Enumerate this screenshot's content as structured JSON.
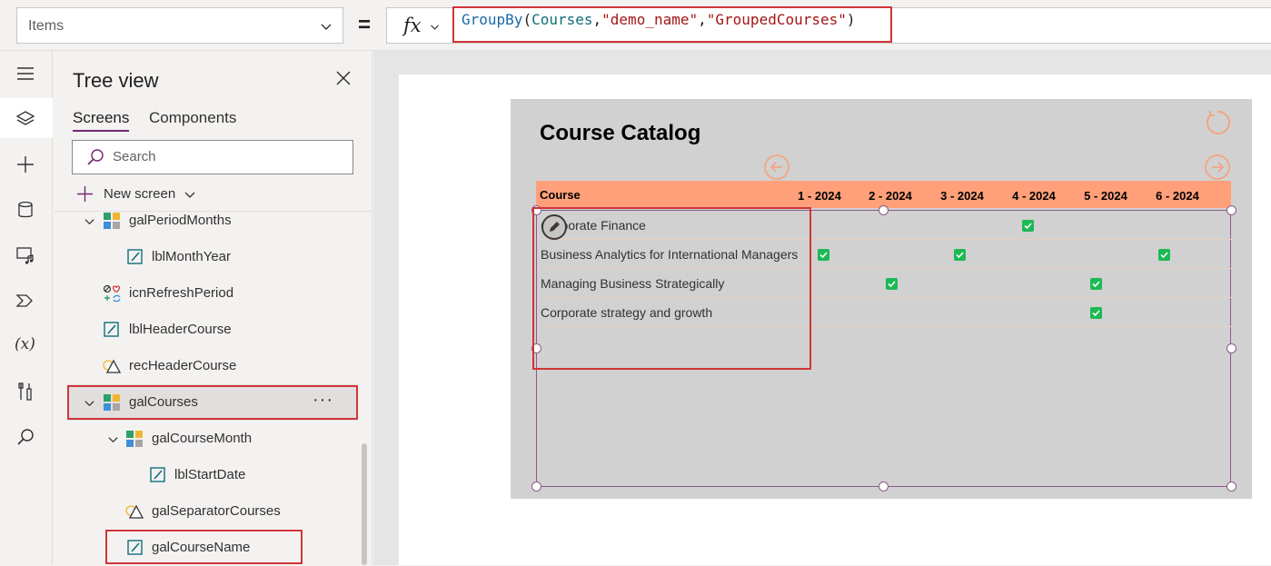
{
  "formula_bar": {
    "property": "Items",
    "fx_label": "fx",
    "equals": "=",
    "formula": {
      "fn": "GroupBy",
      "open": "(",
      "source": "Courses",
      "comma1": ",",
      "arg1": "\"demo_name\"",
      "comma2": ",",
      "arg2": "\"GroupedCourses\"",
      "close": ")"
    }
  },
  "rail": {
    "items": [
      "menu-icon",
      "layers-icon",
      "insert-icon",
      "data-icon",
      "media-icon",
      "power-automate-icon",
      "variables-icon",
      "tools-icon",
      "search-icon"
    ],
    "variables_glyph": "(x)"
  },
  "tree": {
    "title": "Tree view",
    "tabs": [
      "Screens",
      "Components"
    ],
    "search_placeholder": "Search",
    "new_screen_label": "New screen",
    "nodes": [
      {
        "label": "galPeriodMonths",
        "icon": "gallery-icon"
      },
      {
        "label": "lblMonthYear",
        "icon": "label-icon"
      },
      {
        "label": "icnRefreshPeriod",
        "icon": "icon-control-icon"
      },
      {
        "label": "lblHeaderCourse",
        "icon": "label-icon"
      },
      {
        "label": "recHeaderCourse",
        "icon": "shape-icon"
      },
      {
        "label": "galCourses",
        "icon": "gallery-icon",
        "more": "···"
      },
      {
        "label": "galCourseMonth",
        "icon": "gallery-icon"
      },
      {
        "label": "lblStartDate",
        "icon": "label-icon"
      },
      {
        "label": "galSeparatorCourses",
        "icon": "shape-icon"
      },
      {
        "label": "galCourseName",
        "icon": "label-icon"
      }
    ]
  },
  "app": {
    "title": "Course Catalog",
    "header": {
      "course": "Course",
      "months": [
        "1 - 2024",
        "2 - 2024",
        "3 - 2024",
        "4 - 2024",
        "5 - 2024",
        "6 - 2024"
      ]
    },
    "courses": [
      {
        "name": "Corporate Finance",
        "checked": [
          4
        ]
      },
      {
        "name": "Business Analytics for International Managers",
        "checked": [
          1,
          3,
          6
        ]
      },
      {
        "name": "Managing Business Strategically",
        "checked": [
          2,
          5
        ]
      },
      {
        "name": "Corporate strategy and growth",
        "checked": [
          5
        ]
      }
    ],
    "colors": {
      "header_bar": "#ffa07a",
      "accent_orange": "#f4a582",
      "check_green": "#1db954",
      "selection_red": "#d13438",
      "selection_purple": "#8a5b8a"
    }
  }
}
